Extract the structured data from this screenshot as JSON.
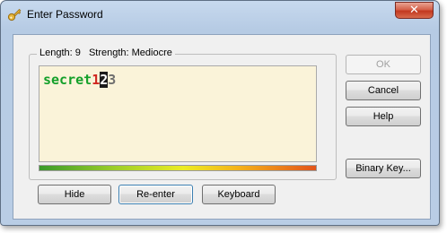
{
  "window": {
    "title": "Enter Password",
    "close_symbol": "✕",
    "icon": "key-icon"
  },
  "group": {
    "length_text": "Length: 9",
    "strength_text": "Strength: Mediocre"
  },
  "password": {
    "letters": "secret",
    "digit_red": "1",
    "selected": "2",
    "rest": "3"
  },
  "buttons": {
    "ok": "OK",
    "cancel": "Cancel",
    "help": "Help",
    "binary_key": "Binary Key...",
    "hide": "Hide",
    "reenter": "Re-enter",
    "keyboard": "Keyboard"
  },
  "colors": {
    "letters": "#14a02a",
    "digit": "#d0261f",
    "field_bg": "#faf3d9"
  }
}
